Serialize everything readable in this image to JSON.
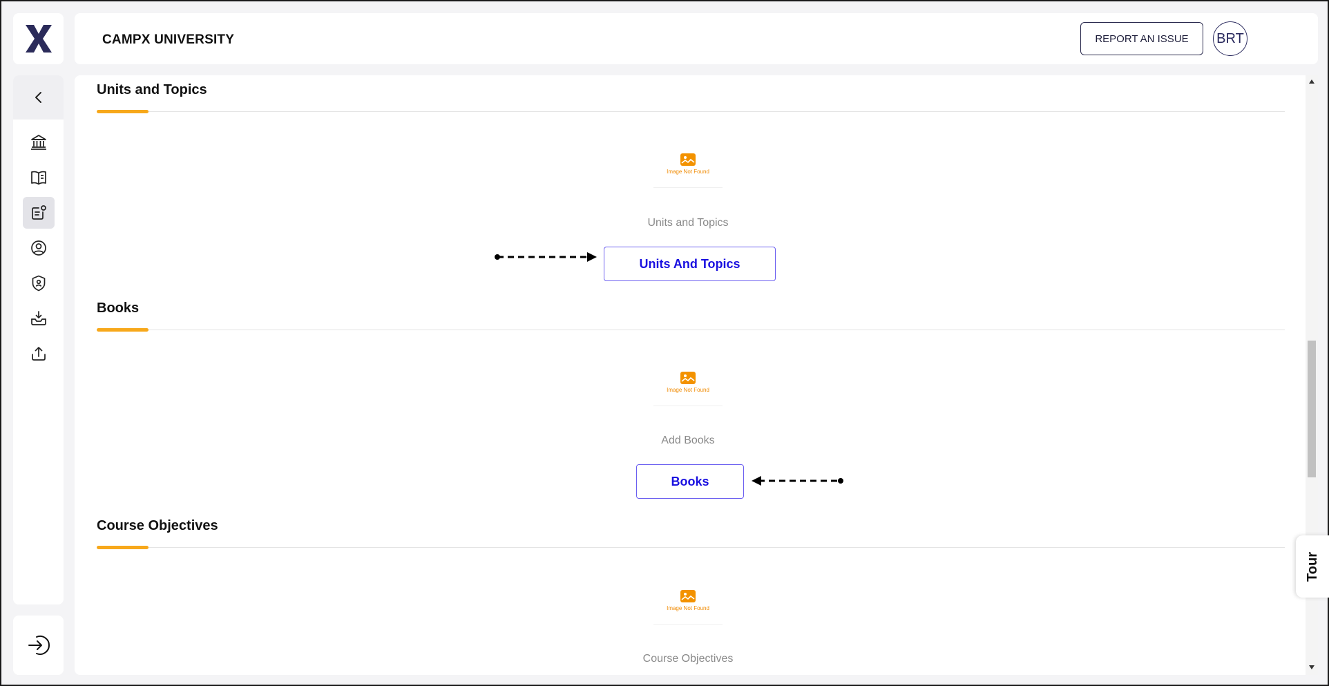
{
  "header": {
    "title": "CAMPX UNIVERSITY",
    "report_label": "REPORT AN ISSUE",
    "avatar_initials": "BRT"
  },
  "sidebar": {
    "items": [
      {
        "icon": "institution-icon"
      },
      {
        "icon": "book-open-icon"
      },
      {
        "icon": "course-badge-icon",
        "active": true
      },
      {
        "icon": "user-circle-icon"
      },
      {
        "icon": "shield-user-icon"
      },
      {
        "icon": "download-tray-icon"
      },
      {
        "icon": "upload-icon"
      }
    ]
  },
  "sections": [
    {
      "title": "Units and Topics",
      "image_caption": "Image Not Found",
      "subtitle": "Units and Topics",
      "button_label": "Units And Topics"
    },
    {
      "title": "Books",
      "image_caption": "Image Not Found",
      "subtitle": "Add Books",
      "button_label": "Books"
    },
    {
      "title": "Course Objectives",
      "image_caption": "Image Not Found",
      "subtitle": "Course Objectives"
    }
  ],
  "tour_label": "Tour",
  "colors": {
    "accent": "#f7a81b",
    "brand": "#2a2a5e",
    "link": "#1a10e0"
  }
}
